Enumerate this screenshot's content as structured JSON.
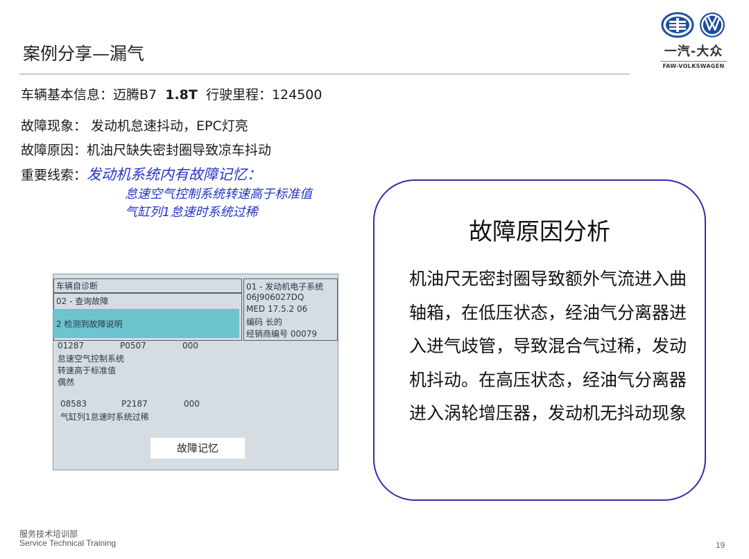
{
  "header": {
    "title": "案例分享—漏气"
  },
  "logo": {
    "brand_cn": "一汽-大众",
    "brand_en": "FAW-VOLKSWAGEN"
  },
  "info": {
    "vehicle_label": "车辆基本信息：迈腾B7",
    "engine": "1.8T",
    "mileage": "行驶里程：124500",
    "symptom": "故障现象：  发动机怠速抖动，EPC灯亮",
    "cause": "故障原因：机油尺缺失密封圈导致凉车抖动",
    "clue_label": "重要线索：",
    "clue_text": "发动机系统内有故障记忆：",
    "clue_line1": "怠速空气控制系统转速高于标准值",
    "clue_line2": "气缸列1怠速时系统过稀"
  },
  "photo": {
    "menu1": "车辆自诊断",
    "menu2": "02 - 查询故障",
    "menu3": "2 检测到故障说明",
    "right1": "01 - 发动机电子系统",
    "right2": "06J906027DQ",
    "right3": "MED 17.5.2      06",
    "right4": "编码  长的",
    "right5": "经销商编号  00079",
    "f1_code": "01287",
    "f1_p": "P0507",
    "f1_n": "000",
    "f1_l1": "怠速空气控制系统",
    "f1_l2": "转速高于标准值",
    "f1_l3": "偶然",
    "f2_code": "08583",
    "f2_p": "P2187",
    "f2_n": "000",
    "f2_l1": "气缸列1怠速时系统过稀",
    "label": "故障记忆"
  },
  "card": {
    "title": "故障原因分析",
    "body": "机油尺无密封圈导致额外气流进入曲轴箱，在低压状态，经油气分离器进入进气歧管，导致混合气过稀，发动机抖动。在高压状态，经油气分离器进入涡轮增压器，发动机无抖动现象"
  },
  "footer": {
    "dept_cn": "服务技术培训部",
    "dept_en": "Service Technical Training",
    "page": "19"
  },
  "colors": {
    "accent_blue": "#2436c8",
    "card_border": "#2b2fa8",
    "screen_teal": "#6cc4cf"
  }
}
